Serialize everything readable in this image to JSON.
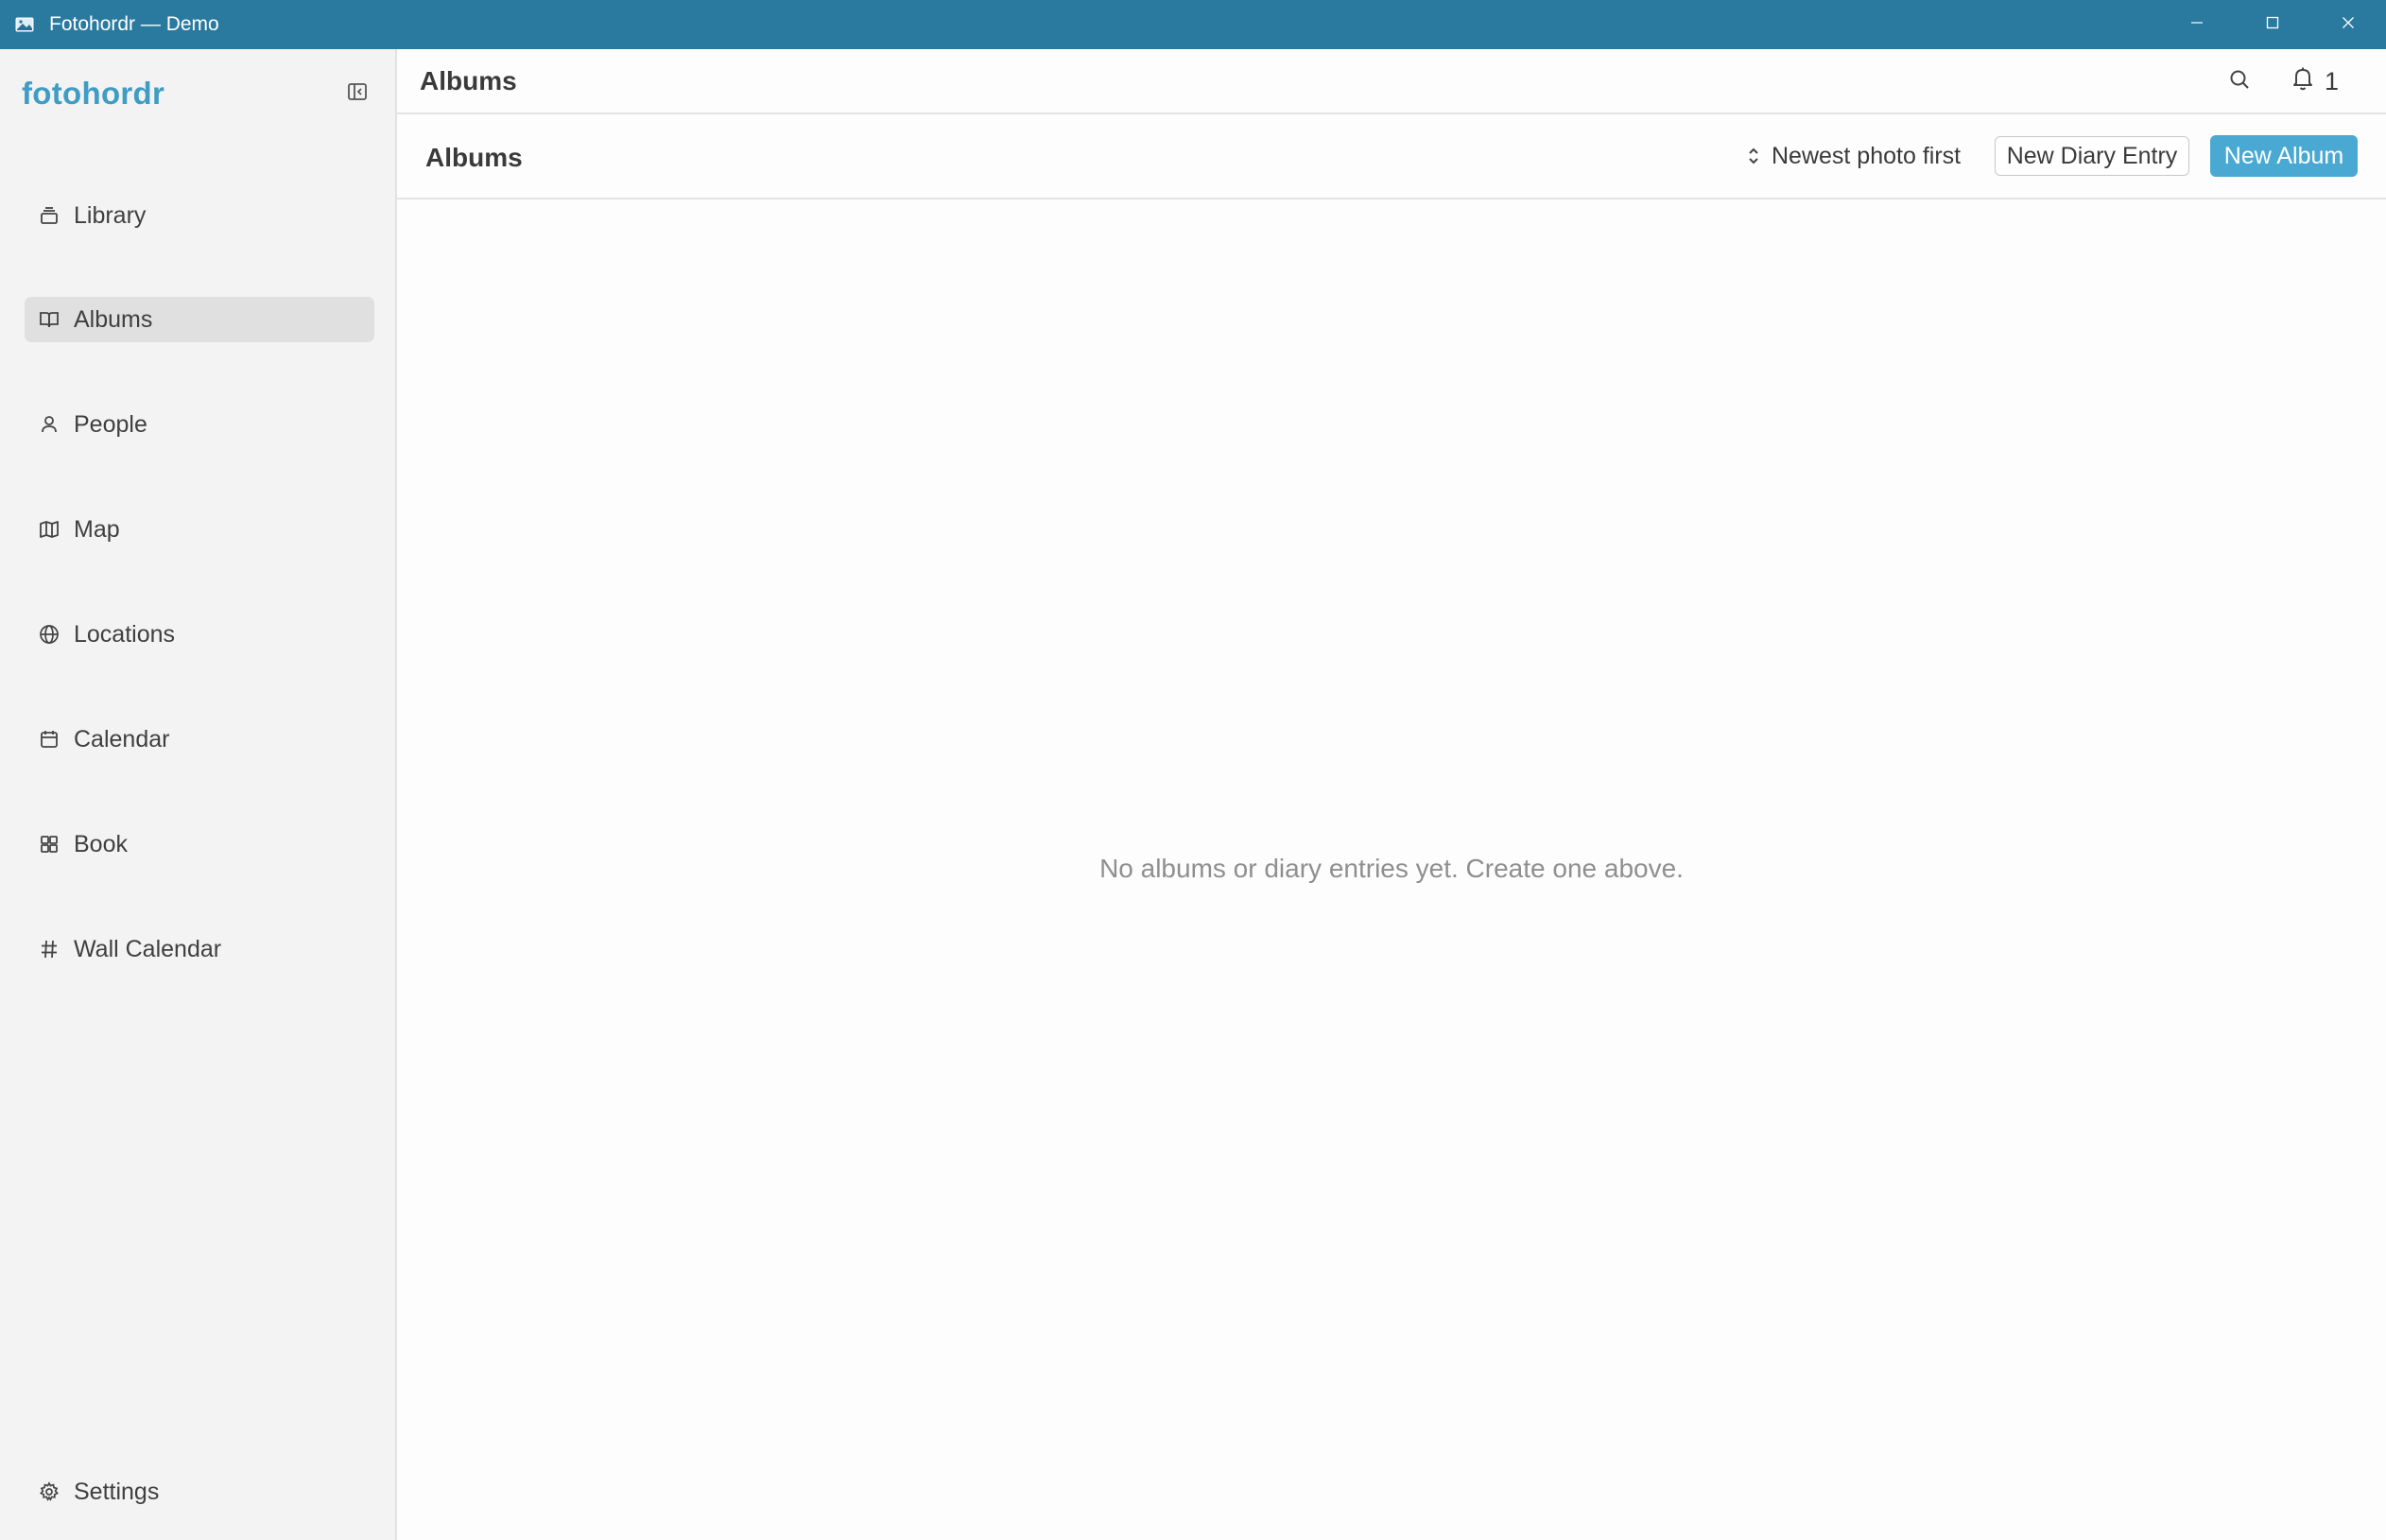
{
  "window": {
    "title": "Fotohordr — Demo",
    "icon": "app-photo-icon",
    "controls": [
      "minimize-icon",
      "maximize-icon",
      "close-icon"
    ]
  },
  "sidebar": {
    "brand": "fotohordr",
    "collapse_icon": "sidebar-collapse-icon",
    "items": [
      {
        "label": "Library",
        "icon": "library-icon",
        "active": false
      },
      {
        "label": "Albums",
        "icon": "book-open-icon",
        "active": true
      },
      {
        "label": "People",
        "icon": "person-icon",
        "active": false
      },
      {
        "label": "Map",
        "icon": "map-icon",
        "active": false
      },
      {
        "label": "Locations",
        "icon": "globe-icon",
        "active": false
      },
      {
        "label": "Calendar",
        "icon": "calendar-icon",
        "active": false
      },
      {
        "label": "Book",
        "icon": "grid-icon",
        "active": false
      },
      {
        "label": "Wall Calendar",
        "icon": "hash-icon",
        "active": false
      }
    ],
    "settings": {
      "label": "Settings",
      "icon": "gear-icon"
    }
  },
  "header": {
    "title": "Albums",
    "search_icon": "search-icon",
    "notifications": {
      "icon": "bell-icon",
      "count": "1"
    }
  },
  "toolbar": {
    "title": "Albums",
    "sort_label": "Newest photo first",
    "new_diary_label": "New Diary Entry",
    "new_album_label": "New Album"
  },
  "main": {
    "empty_message": "No albums or diary entries yet. Create one above."
  },
  "colors": {
    "titlebar": "#2a7aa0",
    "brand": "#3f9cc4",
    "primary_button": "#4aa9d2",
    "sidebar_bg": "#f3f3f3",
    "active_item_bg": "#e0e0e0"
  }
}
